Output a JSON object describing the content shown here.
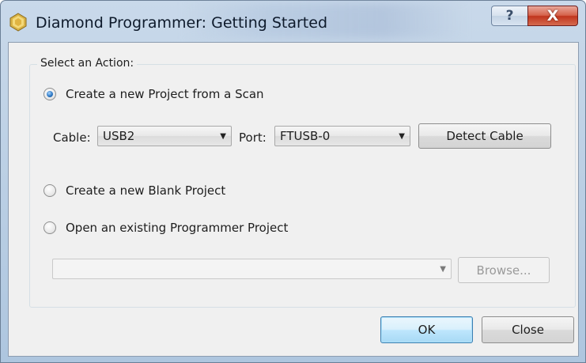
{
  "window": {
    "title": "Diamond Programmer: Getting Started",
    "help_glyph": "?",
    "close_glyph": "X",
    "icons": {
      "app": "diamond-programmer-icon",
      "help": "help-icon",
      "close": "close-icon"
    }
  },
  "group": {
    "label": "Select an Action:"
  },
  "options": [
    {
      "label": "Create a new Project from a Scan",
      "checked": true
    },
    {
      "label": "Create a new Blank Project",
      "checked": false
    },
    {
      "label": "Open an existing Programmer Project",
      "checked": false
    }
  ],
  "scan": {
    "cable_label": "Cable:",
    "cable_value": "USB2",
    "port_label": "Port:",
    "port_value": "FTUSB-0",
    "detect_label": "Detect Cable"
  },
  "open_project": {
    "path_value": "",
    "browse_label": "Browse..."
  },
  "footer": {
    "ok_label": "OK",
    "close_label": "Close"
  },
  "colors": {
    "client_bg": "#f0f0f0",
    "close_button": "#c0351d",
    "default_button_border": "#3c7fb1"
  }
}
